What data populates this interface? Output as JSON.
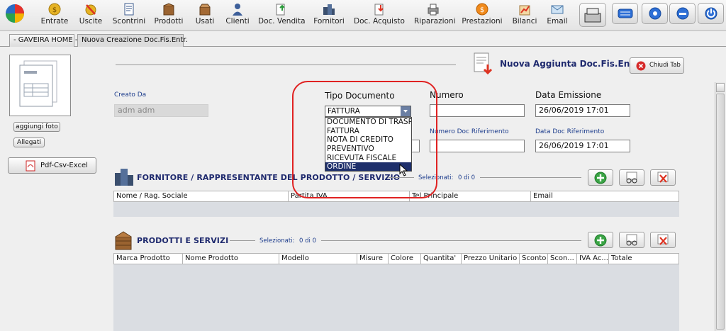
{
  "toolbar": {
    "items": [
      {
        "label": "Entrate",
        "icon": "coins-icon"
      },
      {
        "label": "Uscite",
        "icon": "money-bag-icon"
      },
      {
        "label": "Scontrini",
        "icon": "receipt-icon"
      },
      {
        "label": "Prodotti",
        "icon": "box-icon"
      },
      {
        "label": "Usati",
        "icon": "open-box-icon"
      },
      {
        "label": "Clienti",
        "icon": "user-icon"
      },
      {
        "label": "Doc. Vendita",
        "icon": "document-arrow-up-icon"
      },
      {
        "label": "Fornitori",
        "icon": "supplier-icon"
      },
      {
        "label": "Doc. Acquisto",
        "icon": "document-arrow-down-icon"
      },
      {
        "label": "Riparazioni",
        "icon": "printer-icon"
      },
      {
        "label": "Prestazioni",
        "icon": "gear-coin-icon"
      },
      {
        "label": "Bilanci",
        "icon": "chart-icon"
      },
      {
        "label": "Email",
        "icon": "email-icon"
      }
    ]
  },
  "tabs": [
    {
      "label": "- GAVEIRA HOME -"
    },
    {
      "label": "Nuova Creazione Doc.Fis.Entr."
    }
  ],
  "side": {
    "add_photo_label": "aggiungi foto",
    "attachments_label": "Allegati",
    "export_label": "Pdf-Csv-Excel"
  },
  "header": {
    "title": "Nuova Aggiunta Doc.Fis.Entr.",
    "close_tab_label": "Chiudi Tab"
  },
  "form": {
    "created_by_label": "Creato Da",
    "created_by_value": "adm adm",
    "doc_type_label": "Tipo Documento",
    "doc_type_value": "FATTURA",
    "doc_type_options": [
      "DOCUMENTO DI TRASPORTO",
      "FATTURA",
      "NOTA DI CREDITO",
      "PREVENTIVO",
      "RICEVUTA FISCALE",
      "ORDINE"
    ],
    "doc_type_highlighted": "ORDINE",
    "number_label": "Numero",
    "number_value": "",
    "issue_date_label": "Data Emissione",
    "issue_date_value": "26/06/2019 17:01",
    "ref_number_label": "Numero Doc Riferimento",
    "ref_number_value": "",
    "ref_date_label": "Data Doc Riferimento",
    "ref_date_value": "26/06/2019 17:01"
  },
  "supplier_section": {
    "title": "FORNITORE / RAPPRESENTANTE DEL PRODOTTO / SERVIZIO",
    "selected_label": "Selezionati:",
    "selected_count": "0 di 0",
    "columns": [
      "Nome / Rag. Sociale",
      "Partita IVA",
      "Tel Principale",
      "Email"
    ]
  },
  "products_section": {
    "title": "PRODOTTI E SERVIZI",
    "selected_label": "Selezionati:",
    "selected_count": "0 di 0",
    "columns": [
      "Marca Prodotto",
      "Nome Prodotto",
      "Modello",
      "Misure",
      "Colore",
      "Quantita'",
      "Prezzo Unitario",
      "Sconto",
      "Scon...",
      "IVA Ac...",
      "Totale"
    ]
  },
  "colors": {
    "accent_blue": "#1f2a6e",
    "highlight_red": "#e02222",
    "selection": "#1e2f6b"
  }
}
